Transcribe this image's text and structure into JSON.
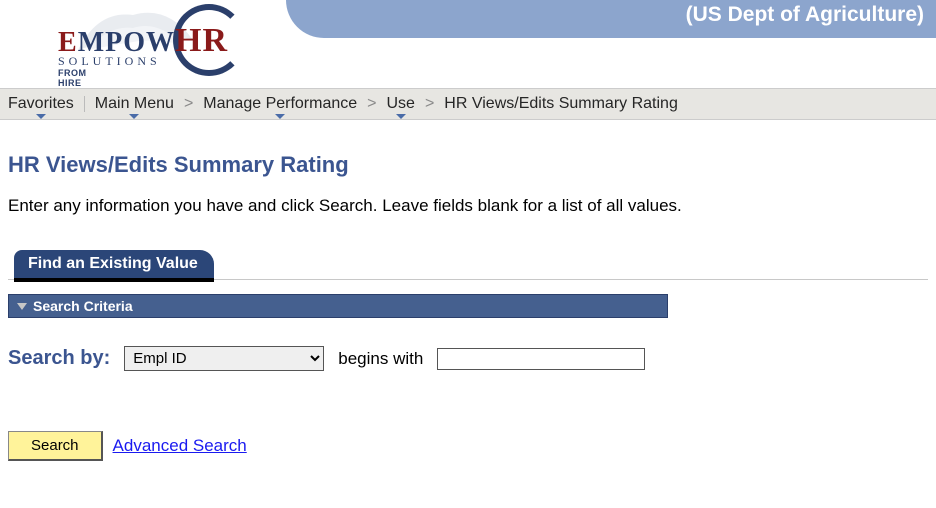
{
  "header": {
    "org_title": "(US Dept of Agriculture)",
    "logo": {
      "main_prefix": "E",
      "main_mid": "MPOW",
      "main_suffix": "HR",
      "sub1": "SOLUTIONS",
      "sub2": "FROM HIRE TO RETIRE"
    }
  },
  "breadcrumb": {
    "items": [
      {
        "label": "Favorites",
        "has_menu": true
      },
      {
        "label": "Main Menu",
        "has_menu": true
      },
      {
        "label": "Manage Performance",
        "has_menu": true
      },
      {
        "label": "Use",
        "has_menu": true
      },
      {
        "label": "HR Views/Edits Summary Rating",
        "has_menu": false
      }
    ]
  },
  "page": {
    "title": "HR Views/Edits Summary Rating",
    "instructions": "Enter any information you have and click Search. Leave fields blank for a list of all values."
  },
  "tab": {
    "label": "Find an Existing Value"
  },
  "criteria_bar": {
    "label": "Search Criteria"
  },
  "search": {
    "by_label": "Search by:",
    "select_value": "Empl ID",
    "operator_label": "begins with",
    "input_value": ""
  },
  "actions": {
    "search_button": "Search",
    "advanced_link": "Advanced Search"
  }
}
